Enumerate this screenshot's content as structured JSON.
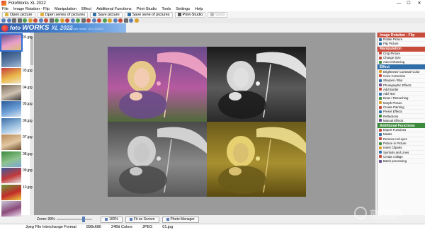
{
  "window": {
    "title": "FotoWorks XL 2022",
    "controls": [
      "—",
      "☐",
      "✕"
    ]
  },
  "menu": [
    "File",
    "Image Rotation - Flip",
    "Manipulation",
    "Effect",
    "Additional Functions",
    "Print-Studio",
    "Tools",
    "Settings",
    "Help"
  ],
  "toolbar": {
    "open_picture": "Open picture",
    "open_series": "Open series of pictures",
    "save_picture": "Save picture",
    "save_series": "Save serie of pictures",
    "print_studio": "Print-Studio",
    "undo": "Undo"
  },
  "logo": {
    "word1": "foto",
    "word2": "WORKS",
    "word3": "XL 2022",
    "last_build": "Last build version: 16.11.2021/02"
  },
  "thumbnails": [
    {
      "label": "01.jpg",
      "selected": true,
      "colors": [
        "#6a4c8c",
        "#e9a0c8",
        "#d9c07a"
      ]
    },
    {
      "label": "",
      "selected": false,
      "colors": [
        "#2a4a7a",
        "#5e7ea6",
        "#a7bcd8"
      ]
    },
    {
      "label": "03.jpg",
      "selected": false,
      "colors": [
        "#c53a3a",
        "#e9b84a",
        "#f2e4c2"
      ]
    },
    {
      "label": "04.jpg",
      "selected": false,
      "colors": [
        "#7a6a5a",
        "#cfc2b2",
        "#3a3a3a"
      ]
    },
    {
      "label": "05.jpg",
      "selected": false,
      "colors": [
        "#2a5a9a",
        "#6d9fd6",
        "#dbe6f2"
      ]
    },
    {
      "label": "06.jpg",
      "selected": false,
      "colors": [
        "#3c6ea8",
        "#9bc0e0",
        "#f0f4f8"
      ]
    },
    {
      "label": "07.jpg",
      "selected": false,
      "colors": [
        "#b88a5a",
        "#e2c8a2",
        "#6a4a2a"
      ]
    },
    {
      "label": "08.jpg",
      "selected": false,
      "colors": [
        "#3c8a3c",
        "#8fc28f",
        "#7aa8d8"
      ]
    },
    {
      "label": "09.jpg",
      "selected": false,
      "colors": [
        "#3a5a9a",
        "#c23a3a",
        "#e8e8e8"
      ]
    },
    {
      "label": "10.jpg",
      "selected": false,
      "colors": [
        "#6a9a3a",
        "#c22a2a",
        "#f0d040"
      ]
    },
    {
      "label": "",
      "selected": false,
      "colors": [
        "#c8c8d8",
        "#8a4a7a",
        "#f0e0f0"
      ]
    }
  ],
  "photo": {
    "quadrants": [
      {
        "name": "color",
        "bg": [
          "#6a4a8a",
          "#b65aa0",
          "#4f6a3a"
        ],
        "hair": "#e6c88a",
        "umbrella": "#f4a6c6",
        "face": "#f2cbb2"
      },
      {
        "name": "bw-high-contrast",
        "bg": [
          "#1a1a1a",
          "#5a5a5a",
          "#2a2a2a"
        ],
        "hair": "#d8d8d8",
        "umbrella": "#f4f4f4",
        "face": "#e0e0e0"
      },
      {
        "name": "grayscale",
        "bg": [
          "#4a4a4a",
          "#8a8a8a",
          "#5a5a5a"
        ],
        "hair": "#cfcfcf",
        "umbrella": "#dedede",
        "face": "#c8c8c8"
      },
      {
        "name": "sepia-yellow",
        "bg": [
          "#6a5a1a",
          "#a89030",
          "#5a4a10"
        ],
        "hair": "#e6d070",
        "umbrella": "#efe090",
        "face": "#d8c070"
      }
    ]
  },
  "right_panel": {
    "sections": [
      {
        "title": "Image Rotation - Flip",
        "color": "red",
        "items": [
          {
            "label": "Rotate Picture",
            "icon": "#2f6ea8"
          },
          {
            "label": "Flip Picture",
            "icon": "#2f6ea8"
          }
        ]
      },
      {
        "title": "Manipulation",
        "color": "red",
        "items": [
          {
            "label": "Crop Picture",
            "icon": "#c84a3a"
          },
          {
            "label": "Change Size",
            "icon": "#c84a3a"
          },
          {
            "label": "Auto-enhancing",
            "icon": "#3c8a3c"
          }
        ]
      },
      {
        "title": "Effect",
        "color": "blue",
        "items": [
          {
            "label": "Brightness/ Contrast/ Color",
            "icon": "#d8a02a"
          },
          {
            "label": "Color Correction",
            "icon": "#c84a3a"
          },
          {
            "label": "Sharpen / Blur",
            "icon": "#2f6ea8"
          },
          {
            "label": "Photographic Effects",
            "icon": "#6a4c8c"
          },
          {
            "label": "Add Border",
            "icon": "#c84a3a"
          },
          {
            "label": "Add Text",
            "icon": "#2f6ea8"
          },
          {
            "label": "Draw / Retouching",
            "icon": "#3c8a3c"
          },
          {
            "label": "Morph Picture",
            "icon": "#d8a02a"
          },
          {
            "label": "Create Painting",
            "icon": "#c84a3a"
          },
          {
            "label": "Preset Effects",
            "icon": "#2f6ea8"
          },
          {
            "label": "Reflections",
            "icon": "#3c8a3c"
          },
          {
            "label": "Manual Effects",
            "icon": "#6a4c8c"
          }
        ]
      },
      {
        "title": "Additional Functions",
        "color": "green",
        "items": [
          {
            "label": "Expert Functions",
            "icon": "#c84a3a"
          },
          {
            "label": "Masks",
            "icon": "#2f6ea8"
          },
          {
            "label": "Remove red eyes",
            "icon": "#c84a3a"
          },
          {
            "label": "Picture in Picture",
            "icon": "#3c8a3c"
          },
          {
            "label": "Insert Cliparts",
            "icon": "#d8a02a"
          },
          {
            "label": "Symbols and Lines",
            "icon": "#2f6ea8"
          },
          {
            "label": "Create collage",
            "icon": "#c84a3a"
          },
          {
            "label": "Batch processing",
            "icon": "#6a4c8c"
          }
        ]
      }
    ]
  },
  "bottom": {
    "zoom_label": "Zoom: 99%",
    "zoom_fraction": 0.78,
    "btn_100": "100%",
    "btn_fit": "Fit on Screen",
    "btn_manager": "Photo Manager"
  },
  "status": {
    "format": "Jpeg File Interchange Format",
    "dimensions": "898x680",
    "colors": "24Bit Colors",
    "type": "JPEG",
    "file": "01.jpg"
  },
  "watermark": {
    "text": "克鲁软件园",
    "sub": "www.keruen.com"
  }
}
